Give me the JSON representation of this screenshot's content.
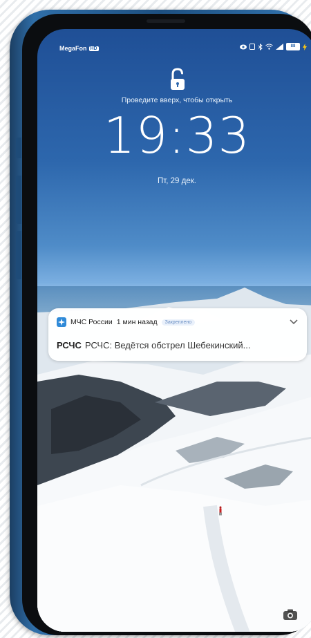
{
  "status_bar": {
    "carrier": "MegaFon",
    "network_badge": "HD",
    "battery": "88"
  },
  "lock_screen": {
    "swipe_hint": "Проведите вверх, чтобы открыть",
    "time": "19:33",
    "date": "Пт, 29 дек."
  },
  "notification": {
    "app_name": "МЧС России",
    "time_ago": "1 мин назад",
    "badge": "Закреплено",
    "title": "РСЧС",
    "text": "РСЧС: Ведётся обстрел Шебекинский..."
  },
  "colors": {
    "sky_top": "#1f4f96",
    "frame_blue": "#2f6ea8",
    "app_icon_blue": "#2f8ad8"
  },
  "icons": {
    "lock": "unlocked-padlock-icon",
    "camera": "camera-icon",
    "expand": "chevron-down-icon"
  }
}
